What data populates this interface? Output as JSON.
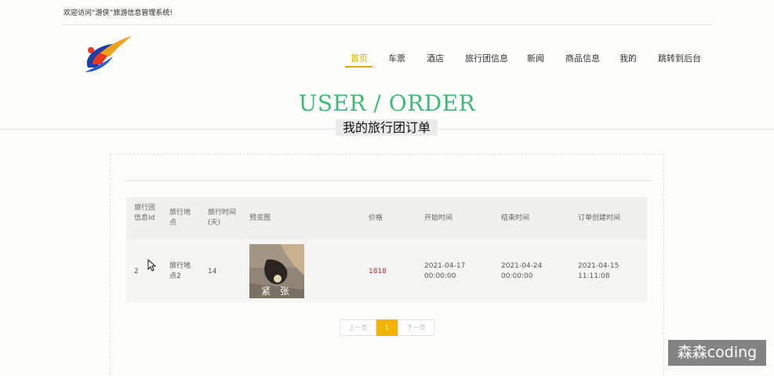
{
  "header": {
    "welcome": "欢迎访问“游侠”旅游信息管理系统!"
  },
  "nav": {
    "items": [
      {
        "label": "首页",
        "active": true
      },
      {
        "label": "车票",
        "active": false
      },
      {
        "label": "酒店",
        "active": false
      },
      {
        "label": "旅行团信息",
        "active": false
      },
      {
        "label": "新闻",
        "active": false
      },
      {
        "label": "商品信息",
        "active": false
      },
      {
        "label": "我的",
        "active": false
      },
      {
        "label": "跳转到后台",
        "active": false
      }
    ]
  },
  "page": {
    "title": "USER / ORDER",
    "subtitle": "我的旅行团订单"
  },
  "table": {
    "headers": [
      "旅行团信息Id",
      "旅行地点",
      "旅行时间(天)",
      "预览图",
      "价格",
      "开始时间",
      "结束时间",
      "订单创建时间"
    ],
    "rows": [
      {
        "id": "2",
        "location": "旅行地点2",
        "days": "14",
        "preview_caption": "紧 张",
        "price": "1818",
        "start": "2021-04-17 00:00:00",
        "end": "2021-04-24 00:00:00",
        "created": "2021-04-15 11:11:08"
      }
    ]
  },
  "pagination": {
    "prev": "上一页",
    "current": "1",
    "next": "下一页"
  },
  "watermark": "森森coding",
  "colors": {
    "accent": "#e6a700",
    "title_green": "#3dba76",
    "price_red": "#d4242c"
  }
}
